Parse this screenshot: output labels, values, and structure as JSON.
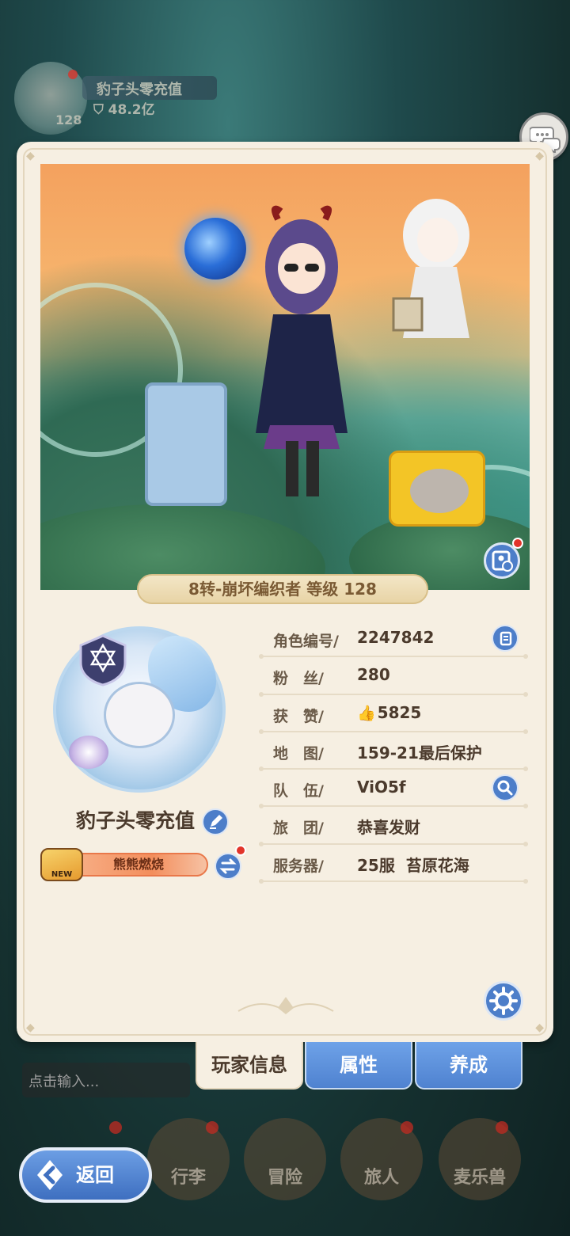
{
  "background": {
    "player_name": "豹子头零充值",
    "power": "48.2亿",
    "level": "128"
  },
  "scene": {
    "rank_banner": "8转-崩坏编织者 等级 128"
  },
  "profile": {
    "name": "豹子头零充值",
    "title_badge": "熊熊燃烧",
    "title_badge_tag": "NEW"
  },
  "info": {
    "rows": [
      {
        "label": "角色编号/",
        "value": "2247842"
      },
      {
        "label": "粉　丝/",
        "value": "280"
      },
      {
        "label": "获　赞/",
        "value": "5825"
      },
      {
        "label": "地　图/",
        "value": "159-21最后保护"
      },
      {
        "label": "队　伍/",
        "value": "ViO5f"
      },
      {
        "label": "旅　团/",
        "value": "恭喜发财"
      },
      {
        "label": "服务器/",
        "value": "25服  苔原花海"
      }
    ]
  },
  "tabs": {
    "player_info": "玩家信息",
    "attributes": "属性",
    "growth": "养成"
  },
  "bottom": {
    "chat_placeholder": "点击输入...",
    "back_label": "返回",
    "nav": [
      "行李",
      "冒险",
      "旅人",
      "麦乐兽"
    ]
  },
  "colors": {
    "accent_blue": "#4d7ec9",
    "card_bg": "#f6efe2",
    "notification_red": "#e2342a"
  },
  "icons": {
    "chat": "chat-bubble-icon",
    "photo": "photo-card-icon",
    "copy": "copy-icon",
    "search": "search-icon",
    "edit": "pencil-icon",
    "swap": "swap-icon",
    "settings": "gear-icon",
    "back": "back-arrow-icon"
  }
}
